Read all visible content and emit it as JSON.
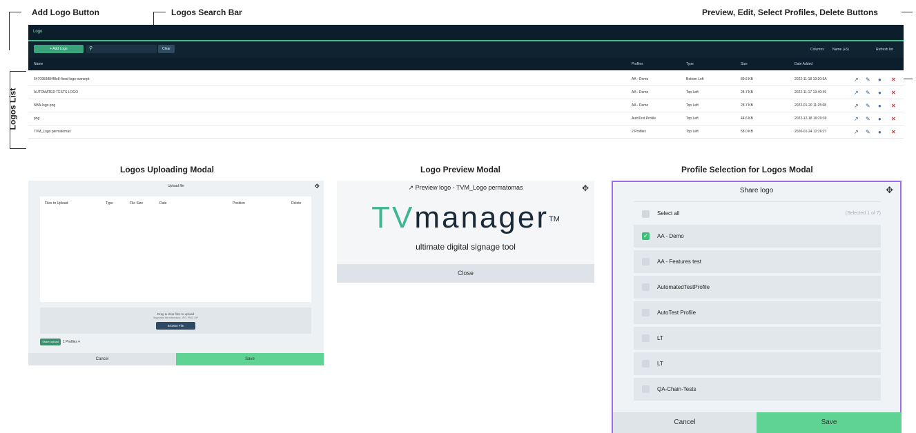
{
  "annotations": {
    "add_logo_button": "Add Logo Button",
    "logos_search_bar": "Logos Search Bar",
    "action_buttons": "Preview, Edit, Select Profiles, Delete Buttons",
    "logos_list": "Logos List",
    "uploading_modal": "Logos Uploading Modal",
    "preview_modal": "Logo Preview Modal",
    "profile_modal": "Profile Selection for Logos Modal"
  },
  "app": {
    "title": "Logo",
    "add_label": "+ Add Logo",
    "clear_label": "Clear",
    "columns_label": "Columns",
    "columns_value": "Name (+5)",
    "refresh_label": "Refresh list",
    "headers": [
      "Name",
      "Profiles",
      "Type",
      "Size",
      "Date Added"
    ],
    "rows": [
      {
        "name": "5470959884f8e8-fixed-logo-ownerpt",
        "profiles": "AA - Demo",
        "type": "Bottom Left",
        "size": "89.6 KB",
        "date": "2022-11-18 19:20:5A"
      },
      {
        "name": "AUTOMATED TESTS LOGO",
        "profiles": "AA - Demo",
        "type": "Top Left",
        "size": "28.7 KB",
        "date": "2022-11-17 13:40:49"
      },
      {
        "name": "NBA-logo.png",
        "profiles": "AA - Demo",
        "type": "Top Left",
        "size": "28.7 KB",
        "date": "2022-01-20 11:25:08"
      },
      {
        "name": "png",
        "profiles": "AutoTest Profile",
        "type": "Top Left",
        "size": "44.6 KB",
        "date": "2022-12-18 19:20:39"
      },
      {
        "name": "TVM_Logo permatomas",
        "profiles": "2 Profiles",
        "type": "Top Left",
        "size": "58.0 KB",
        "date": "2020-01-24 12:26:27"
      }
    ]
  },
  "upload_modal": {
    "title": "Upload file",
    "columns": [
      "Files to Upload",
      "Type",
      "File Size",
      "Date",
      "Position",
      "Delete"
    ],
    "drop_text": "Drag & drop files to upload",
    "supported_text": "Supported file extensions: JPG, PNG, GIF",
    "browse_label": "Browse File",
    "share_label": "Share upload",
    "profiles_label": "1 Profiles",
    "cancel_label": "Cancel",
    "save_label": "Save"
  },
  "preview_modal": {
    "title": "Preview logo - TVM_Logo permatomas",
    "brand_tv": "TV",
    "brand_rest": "manager",
    "brand_tm": "TM",
    "tagline": "ultimate digital signage tool",
    "close_label": "Close"
  },
  "share_modal": {
    "title": "Share logo",
    "select_all": "Select all",
    "selected_count": "(Selected 1 of 7)",
    "profiles": [
      {
        "label": "AA - Demo",
        "checked": true
      },
      {
        "label": "AA - Features test",
        "checked": false
      },
      {
        "label": "AutomatedTestProfile",
        "checked": false
      },
      {
        "label": "AutoTest Profile",
        "checked": false
      },
      {
        "label": "LT",
        "checked": false
      },
      {
        "label": "LT",
        "checked": false
      },
      {
        "label": "QA-Chain-Tests",
        "checked": false
      }
    ],
    "cancel_label": "Cancel",
    "save_label": "Save"
  },
  "colors": {
    "accent": "#3fc08d",
    "dark": "#0c1d2b",
    "delete": "#e03131",
    "modal_border": "#9d6be6"
  }
}
